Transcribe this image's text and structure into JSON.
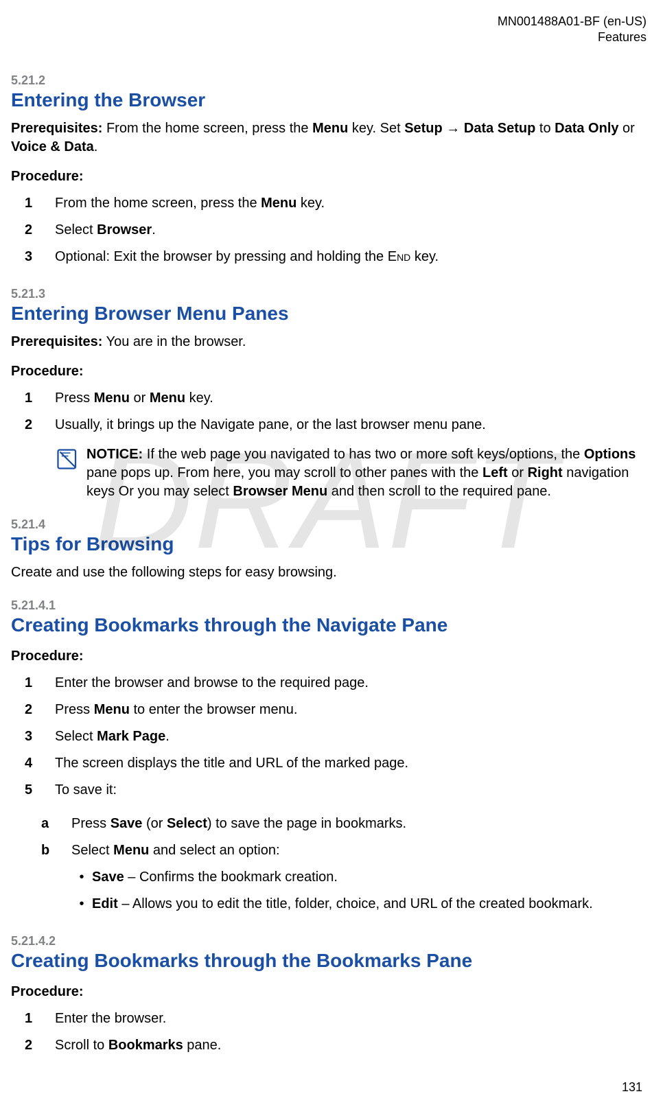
{
  "header": {
    "doc_id": "MN001488A01-BF (en-US)",
    "section": "Features"
  },
  "watermark": "DRAFT",
  "sections": {
    "s1": {
      "num": "5.21.2",
      "title": "Entering the Browser"
    },
    "s2": {
      "num": "5.21.3",
      "title": "Entering Browser Menu Panes"
    },
    "s3": {
      "num": "5.21.4",
      "title": "Tips for Browsing"
    },
    "s4": {
      "num": "5.21.4.1",
      "title": "Creating Bookmarks through the Navigate Pane"
    },
    "s5": {
      "num": "5.21.4.2",
      "title": "Creating Bookmarks through the Bookmarks Pane"
    }
  },
  "labels": {
    "prereq": "Prerequisites:",
    "procedure": "Procedure:",
    "notice": "NOTICE:"
  },
  "s1": {
    "prereq_pre": " From the home screen, press the ",
    "menu": "Menu",
    "prereq_mid1": " key. Set ",
    "setup": "Setup",
    "arrow": " → ",
    "data_setup": "Data Setup",
    "prereq_mid2": " to ",
    "data_only": "Data Only",
    "or": " or ",
    "voice_data": "Voice & Data",
    "period": ".",
    "steps": {
      "n1": "1",
      "t1a": "From the home screen, press the ",
      "t1b": "Menu",
      "t1c": " key.",
      "n2": "2",
      "t2a": "Select ",
      "t2b": "Browser",
      "t2c": ".",
      "n3": "3",
      "t3a": "Optional: Exit the browser by pressing and holding the ",
      "t3b": "End",
      "t3c": " key."
    }
  },
  "s2": {
    "prereq": " You are in the browser.",
    "steps": {
      "n1": "1",
      "t1a": "Press ",
      "t1b": "Menu",
      "t1c": " or ",
      "t1d": "Menu",
      "t1e": " key.",
      "n2": "2",
      "t2": "Usually, it brings up the Navigate pane, or the last browser menu pane."
    },
    "notice": {
      "a": " If the web page you navigated to has two or more soft keys/options, the ",
      "b": "Options",
      "c": " pane pops up. From here, you may scroll to other panes with the ",
      "d": "Left",
      "e": " or ",
      "f": "Right",
      "g": " navigation keys Or you may select ",
      "h": "Browser Menu",
      "i": " and then scroll to the required pane."
    }
  },
  "s3": {
    "intro": "Create and use the following steps for easy browsing."
  },
  "s4": {
    "steps": {
      "n1": "1",
      "t1": "Enter the browser and browse to the required page.",
      "n2": "2",
      "t2a": "Press ",
      "t2b": "Menu",
      "t2c": " to enter the browser menu.",
      "n3": "3",
      "t3a": "Select ",
      "t3b": "Mark Page",
      "t3c": ".",
      "n4": "4",
      "t4": "The screen displays the title and URL of the marked page.",
      "n5": "5",
      "t5": "To save it:"
    },
    "sub": {
      "na": "a",
      "ta1": "Press ",
      "ta2": "Save",
      "ta3": " (or ",
      "ta4": "Select",
      "ta5": ") to save the page in bookmarks.",
      "nb": "b",
      "tb1": "Select ",
      "tb2": "Menu",
      "tb3": " and select an option:"
    },
    "bullets": {
      "b1a": "Save",
      "b1b": " – Confirms the bookmark creation.",
      "b2a": "Edit",
      "b2b": " – Allows you to edit the title, folder, choice, and URL of the created bookmark."
    }
  },
  "s5": {
    "steps": {
      "n1": "1",
      "t1": "Enter the browser.",
      "n2": "2",
      "t2a": "Scroll to ",
      "t2b": "Bookmarks",
      "t2c": " pane."
    }
  },
  "page_number": "131"
}
